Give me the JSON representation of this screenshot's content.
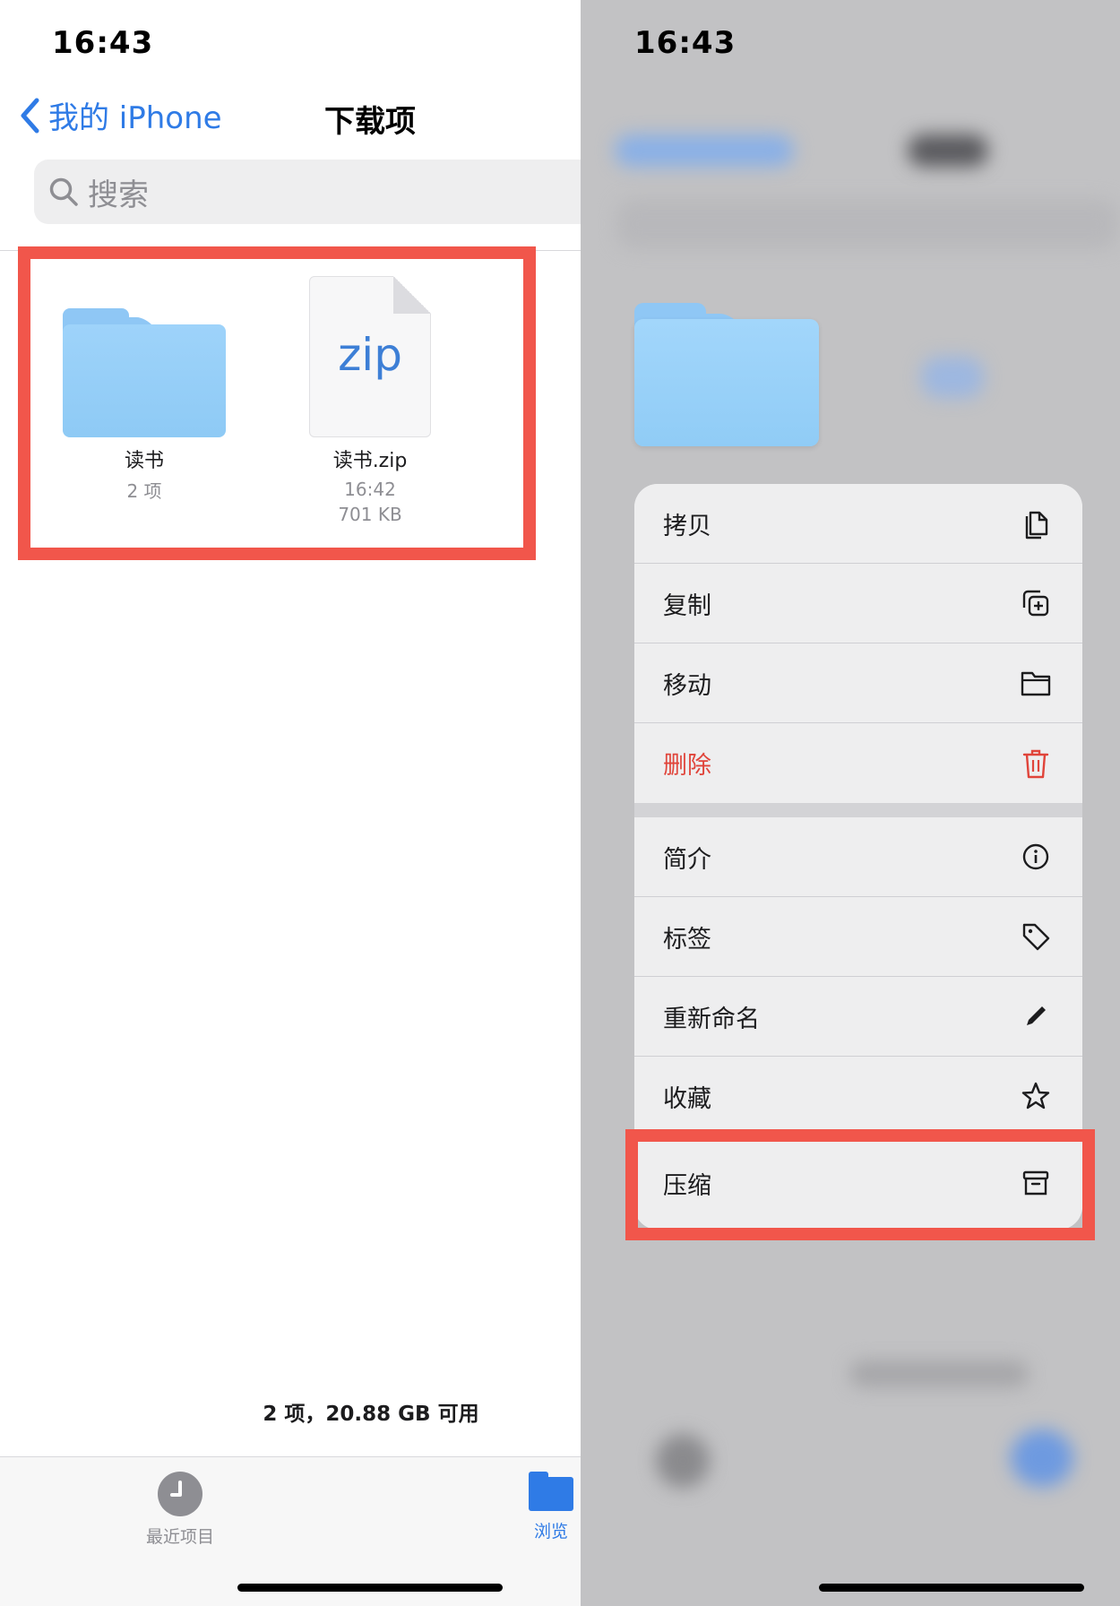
{
  "left": {
    "status_time": "16:43",
    "back_label": "我的 iPhone",
    "title": "下载项",
    "search_placeholder": "搜索",
    "items": [
      {
        "name": "读书",
        "sub1": "2 项",
        "sub2": ""
      },
      {
        "name": "读书.zip",
        "sub1": "16:42",
        "sub2": "701 KB",
        "icon_text": "zip"
      }
    ],
    "storage_text": "2 项，20.88 GB 可用",
    "tabs": [
      {
        "label": "最近项目",
        "icon": "clock-icon"
      },
      {
        "label": "浏览",
        "icon": "folder-icon"
      }
    ],
    "highlight_color": "#f1564b",
    "accent_color": "#2f7be6"
  },
  "right": {
    "status_time": "16:43",
    "menu_groups": [
      [
        {
          "label": "拷贝",
          "icon": "copy-icon"
        },
        {
          "label": "复制",
          "icon": "duplicate-icon"
        },
        {
          "label": "移动",
          "icon": "folder-icon"
        },
        {
          "label": "删除",
          "icon": "trash-icon",
          "destructive": true
        }
      ],
      [
        {
          "label": "简介",
          "icon": "info-icon"
        },
        {
          "label": "标签",
          "icon": "tag-icon"
        },
        {
          "label": "重新命名",
          "icon": "pencil-icon"
        },
        {
          "label": "收藏",
          "icon": "star-icon"
        },
        {
          "label": "压缩",
          "icon": "archive-box-icon"
        }
      ]
    ],
    "destructive_color": "#e0443a"
  }
}
